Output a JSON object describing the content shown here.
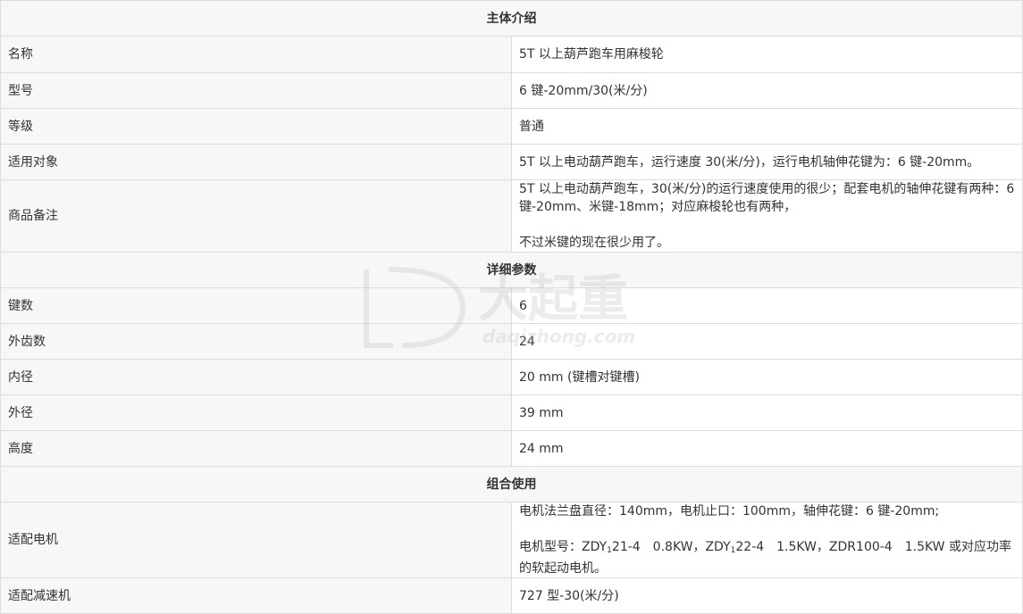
{
  "sections": {
    "main_intro": "主体介绍",
    "detail_params": "详细参数",
    "combo_use": "组合使用"
  },
  "rows": {
    "name": {
      "label": "名称",
      "value": "5T 以上葫芦跑车用麻梭轮"
    },
    "model": {
      "label": "型号",
      "value": "6 键-20mm/30(米/分)"
    },
    "grade": {
      "label": "等级",
      "value": "普通"
    },
    "applicable": {
      "label": "适用对象",
      "value": "5T 以上电动葫芦跑车，运行速度 30(米/分)，运行电机轴伸花键为：6 键-20mm。"
    },
    "remarks": {
      "label": "商品备注",
      "value_line1": "5T 以上电动葫芦跑车，30(米/分)的运行速度使用的很少；配套电机的轴伸花键有两种：6 键-20mm、米键-18mm；对应麻梭轮也有两种，",
      "value_line2": "不过米键的现在很少用了。"
    },
    "keys": {
      "label": "键数",
      "value": "6"
    },
    "outer_teeth": {
      "label": "外齿数",
      "value": "24"
    },
    "inner_diameter": {
      "label": "内径",
      "value": "20 mm (键槽对键槽)"
    },
    "outer_diameter": {
      "label": "外径",
      "value": "39 mm"
    },
    "height": {
      "label": "高度",
      "value": "24 mm"
    },
    "motor": {
      "label": "适配电机",
      "value_line1": "电机法兰盘直径：140mm，电机止口：100mm，轴伸花键：6 键-20mm;",
      "line2_a": "电机型号：ZDY",
      "line2_sub1": "1",
      "line2_b": "21-4　0.8KW，ZDY",
      "line2_sub2": "1",
      "line2_c": "22-4　1.5KW，ZDR100-4　1.5KW 或对应功率的软起动电机。"
    },
    "reducer": {
      "label": "适配减速机",
      "value": "727 型-30(米/分)"
    }
  },
  "watermark": {
    "brand": "大起重",
    "domain": "daqizhong.com"
  },
  "colors": {
    "border": "#dcdcdc",
    "label_bg": "#f7f7f7",
    "text": "#333333"
  }
}
